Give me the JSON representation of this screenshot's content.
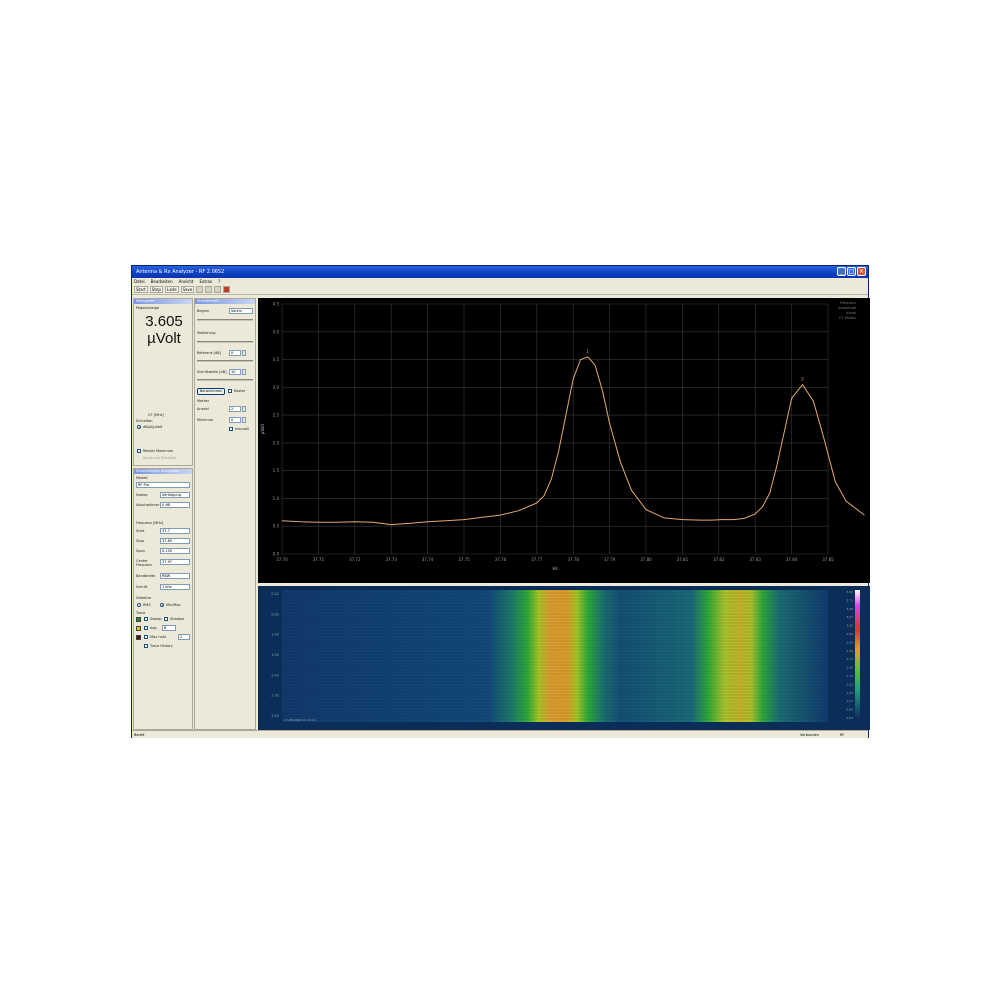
{
  "window": {
    "title": "Antenna & Rx Analyzer - RF 2.0652",
    "minimize": "_",
    "maximize": "□",
    "close": "×"
  },
  "menu": [
    "Datei",
    "Bearbeiten",
    "Ansicht",
    "Extras",
    "?"
  ],
  "toolbar": {
    "buttons": [
      "Start",
      "Stop",
      "Lade",
      "Save"
    ]
  },
  "level_panel": {
    "title": "Messwerte",
    "label": "Pegelanzeige",
    "value": "3.605",
    "unit": "µVolt",
    "freq_line": "CF [MHz]",
    "unit_label": "Einheiten",
    "unit_option": "dBµV/µVolt",
    "max_hold": "Relativ Maximum",
    "extra": "Alarm bei Schwelle"
  },
  "cursor_panel": {
    "title": "Sichtbereich",
    "start_label": "Beginn",
    "start_value": "Vorein",
    "scale_label": "Skalierung",
    "ref_label": "Referenz [dB]",
    "ref_value": "0",
    "step_label": "Schrittweite [dB]",
    "step_value": "10",
    "autoscale_btn": "Neuzeichnen",
    "ruler_label": "Raster",
    "marker_label": "Marker",
    "marker1_label": "Anzahl",
    "marker1_value": "2",
    "marker2_label": "Minimum",
    "marker2_value": "0",
    "manual_label": "manuell"
  },
  "settings_panel": {
    "title": "Einstellungen Analysator",
    "mode_label": "Modell",
    "mode_value": "RF Pro",
    "sweep_label": "Sweep",
    "sweep_value": "Verfolgung",
    "atten_label": "Abschwächer",
    "atten_value": "0 dB",
    "range_label": "Frequenz [MHz]",
    "start_label": "Start",
    "start_value": "37.7",
    "stop_label": "Stop",
    "stop_value": "37.85",
    "span_label": "Span",
    "span_value": "0.150",
    "center_label": "Center Frequenz",
    "center_value": "37.97",
    "rbw_label": "Bandbreite",
    "rbw_value": "RBW",
    "step_label": "Schritt",
    "step_value": "1 kHz",
    "detector_label": "Detektor",
    "detector_a": "RMS",
    "detector_b": "Min/Max",
    "trace_label": "Trace",
    "trace1": "Sweep",
    "trace1b": "Shadow",
    "trace2": "Avg",
    "trace2_value": "8",
    "trace3": "Max hold",
    "trace3_value": "2",
    "trace_history": "Trace History",
    "colors": [
      "#1f8f2a",
      "#e3c21a",
      "#5a0d0d"
    ]
  },
  "chart_data": [
    {
      "type": "line",
      "title": "",
      "xlabel": "Hz",
      "ylabel": "µVolt",
      "grid": true,
      "xlim": [
        37.7,
        37.85
      ],
      "ylim": [
        0.0,
        4.5
      ],
      "x_ticks": [
        "37.70",
        "37.71",
        "37.72",
        "37.73",
        "37.74",
        "37.75",
        "37.76",
        "37.77",
        "37.78",
        "37.79",
        "37.80",
        "37.81",
        "37.82",
        "37.83",
        "37.84",
        "37.85"
      ],
      "y_ticks": [
        "0.0",
        "0.5",
        "1.0",
        "1.5",
        "2.0",
        "2.5",
        "3.0",
        "3.5",
        "4.0",
        "4.5"
      ],
      "series": [
        {
          "color": "#e6a86a",
          "x": [
            37.7,
            37.705,
            37.71,
            37.715,
            37.72,
            37.725,
            37.73,
            37.735,
            37.74,
            37.745,
            37.75,
            37.755,
            37.76,
            37.765,
            37.77,
            37.772,
            37.774,
            37.776,
            37.778,
            37.78,
            37.782,
            37.784,
            37.786,
            37.788,
            37.79,
            37.793,
            37.796,
            37.8,
            37.805,
            37.81,
            37.815,
            37.818,
            37.821,
            37.824,
            37.827,
            37.83,
            37.832,
            37.834,
            37.836,
            37.838,
            37.84,
            37.843,
            37.846,
            37.849,
            37.852,
            37.855,
            37.86
          ],
          "y": [
            0.6,
            0.58,
            0.57,
            0.57,
            0.58,
            0.57,
            0.53,
            0.55,
            0.58,
            0.6,
            0.62,
            0.66,
            0.7,
            0.78,
            0.92,
            1.05,
            1.35,
            1.85,
            2.5,
            3.15,
            3.5,
            3.55,
            3.4,
            2.95,
            2.35,
            1.65,
            1.15,
            0.8,
            0.65,
            0.62,
            0.61,
            0.61,
            0.62,
            0.62,
            0.64,
            0.72,
            0.85,
            1.1,
            1.6,
            2.2,
            2.8,
            3.05,
            2.75,
            2.05,
            1.3,
            0.95,
            0.7
          ]
        }
      ],
      "annotations": [
        "1",
        "2"
      ],
      "legend": [
        "Frequenz",
        "Amplitude",
        "Kanal",
        "CF Modus"
      ]
    },
    {
      "type": "heatmap",
      "title": "",
      "ylabel_ticks": [
        "0.42",
        "0.92",
        "1.42",
        "1.92",
        "2.42",
        "2.92",
        "3.42"
      ],
      "colorbar_ticks": [
        "3.93",
        "3.71",
        "3.49",
        "3.27",
        "3.05",
        "2.83",
        "2.61",
        "2.39",
        "2.17",
        "1.95",
        "1.73",
        "1.51",
        "1.29",
        "1.07",
        "0.85",
        "0.63"
      ],
      "bottom_text": "17.08.2008 10:22:13"
    }
  ],
  "status": {
    "left": "Bereit",
    "right_a": "Verbunden",
    "right_b": "RF"
  }
}
